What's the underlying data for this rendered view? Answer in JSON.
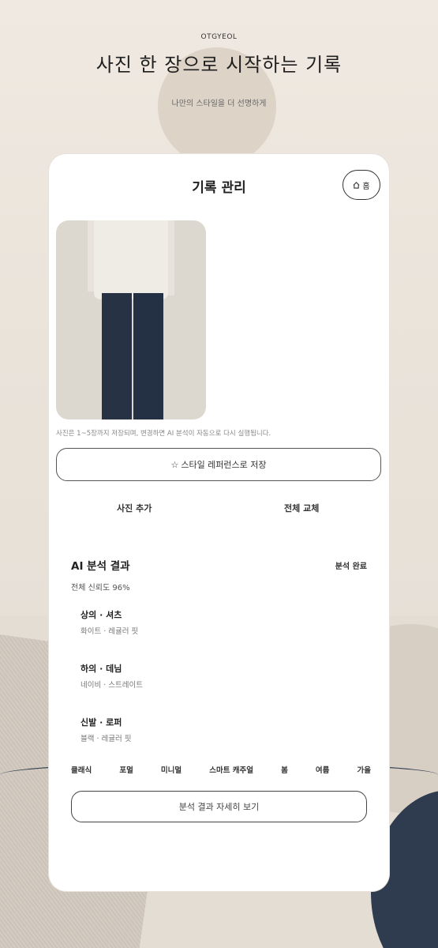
{
  "brand": "OTGYEOL",
  "headline": "사진 한 장으로 시작하는 기록",
  "subheadline": "나만의 스타일을 더 선명하게",
  "card": {
    "title": "기록 관리",
    "home_label": "홈",
    "photo_note": "사진은 1~5장까지 저장되며, 변경하면 AI 분석이 자동으로 다시 실행됩니다.",
    "save_button": {
      "icon": "☆",
      "label": "스타일 레퍼런스로 저장"
    },
    "actions": {
      "add_photo": "사진 추가",
      "replace_all": "전체 교체"
    }
  },
  "analysis": {
    "title": "AI 분석 결과",
    "status": "분석 완료",
    "confidence": "전체 신뢰도 96%",
    "items": [
      {
        "name": "상의 · 셔츠",
        "detail": "화이트 · 레귤러 핏"
      },
      {
        "name": "하의 · 데님",
        "detail": "네이비 · 스트레이트"
      },
      {
        "name": "신발 · 로퍼",
        "detail": "블랙 · 레귤러 핏"
      }
    ],
    "tags": [
      "클래식",
      "포멀",
      "미니멀",
      "스마트 캐주얼",
      "봄",
      "여름",
      "가을"
    ],
    "detail_button": "분석 결과 자세히 보기"
  },
  "colors": {
    "background": "#ece6dd",
    "card": "#ffffff",
    "navy": "#2f3b4f"
  }
}
